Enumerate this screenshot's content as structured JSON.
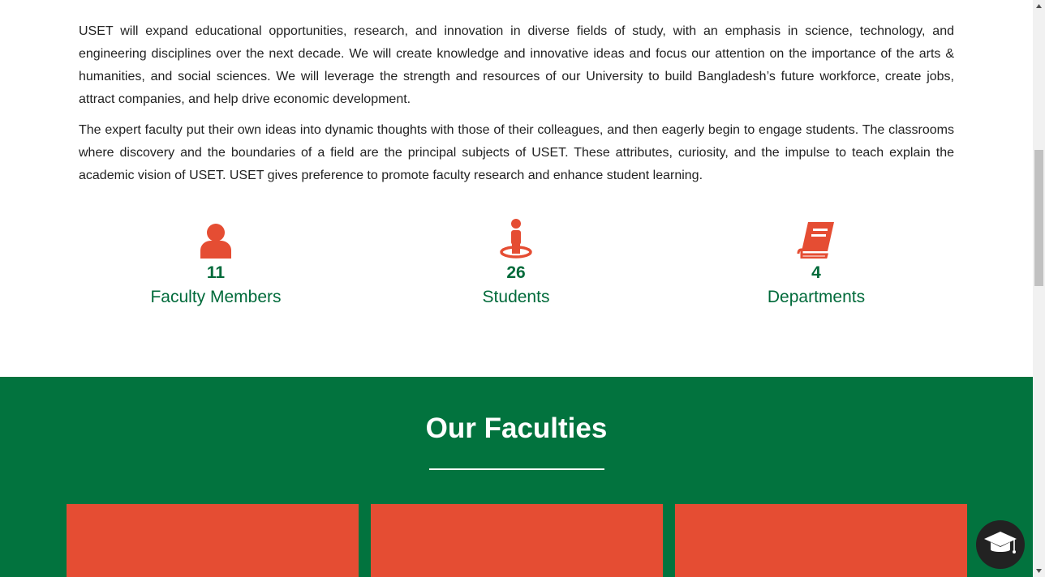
{
  "intro": {
    "paragraph_1": "USET will expand educational opportunities, research, and innovation in diverse fields of study, with an emphasis in science, technology, and engineering disciplines over the next decade. We will create knowledge and innovative ideas and focus our attention on the importance of the arts & humanities, and social sciences. We will leverage the strength and resources of our University to build Bangladesh’s future workforce, create jobs, attract companies, and help drive economic development.",
    "paragraph_2": "The expert faculty put their own ideas into dynamic thoughts with those of their colleagues, and then eagerly begin to engage students. The classrooms where discovery and the boundaries of a field are the principal subjects of USET. These attributes, curiosity, and the impulse to teach explain the academic vision of USET. USET gives preference to promote faculty research and enhance student learning."
  },
  "stats": [
    {
      "icon": "user-icon",
      "count": "11",
      "label": "Faculty Members"
    },
    {
      "icon": "student-icon",
      "count": "26",
      "label": "Students"
    },
    {
      "icon": "book-icon",
      "count": "4",
      "label": "Departments"
    }
  ],
  "faculties": {
    "title": "Our Faculties",
    "cards": [
      "",
      "",
      ""
    ]
  },
  "floating_button": {
    "icon": "graduation-cap-icon"
  },
  "colors": {
    "accent_red": "#e54d33",
    "brand_green": "#02733e",
    "text_green": "#006a3a",
    "fab_dark": "#222222"
  }
}
